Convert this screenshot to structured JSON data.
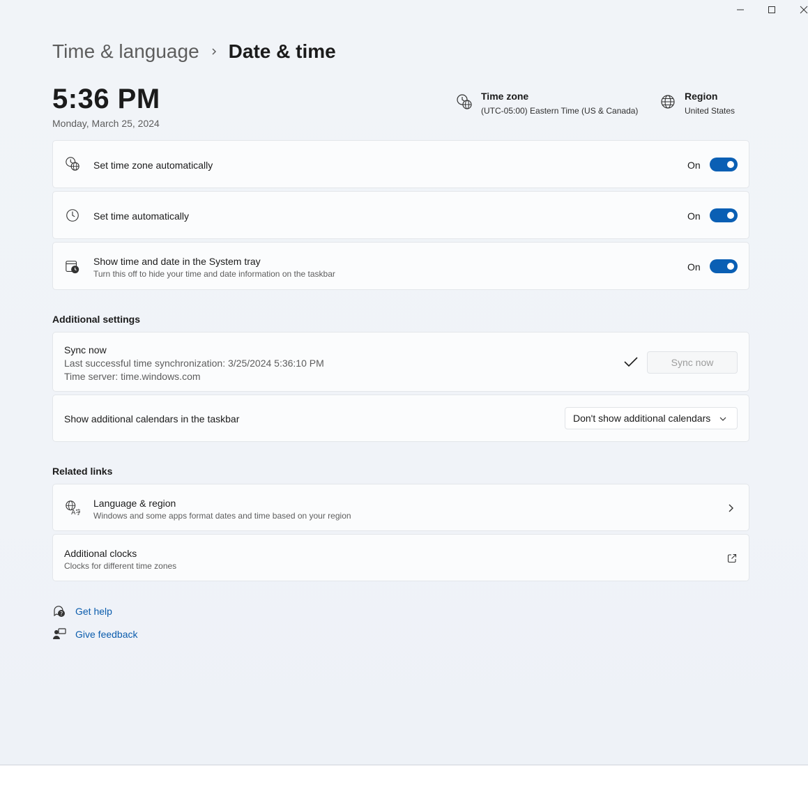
{
  "breadcrumb": {
    "parent": "Time & language",
    "current": "Date & time"
  },
  "clock": {
    "time": "5:36 PM",
    "date": "Monday, March 25, 2024"
  },
  "time_zone": {
    "title": "Time zone",
    "value": "(UTC-05:00) Eastern Time (US & Canada)",
    "icon": "clock-globe-icon"
  },
  "region": {
    "title": "Region",
    "value": "United States",
    "icon": "globe-icon"
  },
  "settings": [
    {
      "label": "Set time zone automatically",
      "state": "On",
      "icon": "clock-globe-icon"
    },
    {
      "label": "Set time automatically",
      "state": "On",
      "icon": "clock-icon"
    },
    {
      "label": "Show time and date in the System tray",
      "sublabel": "Turn this off to hide your time and date information on the taskbar",
      "state": "On",
      "icon": "calendar-clock-icon"
    }
  ],
  "additional": {
    "title": "Additional settings",
    "sync": {
      "label": "Sync now",
      "last_sync": "Last successful time synchronization: 3/25/2024 5:36:10 PM",
      "server": "Time server: time.windows.com",
      "button": "Sync now"
    },
    "calendars": {
      "label": "Show additional calendars in the taskbar",
      "selected": "Don't show additional calendars"
    }
  },
  "related": {
    "title": "Related links",
    "items": [
      {
        "label": "Language & region",
        "sublabel": "Windows and some apps format dates and time based on your region",
        "icon": "language-icon"
      },
      {
        "label": "Additional clocks",
        "sublabel": "Clocks for different time zones",
        "icon": "external-link-icon"
      }
    ]
  },
  "help": {
    "get_help": "Get help",
    "give_feedback": "Give feedback"
  },
  "colors": {
    "accent": "#0a5fb4",
    "link": "#0b5cad"
  }
}
